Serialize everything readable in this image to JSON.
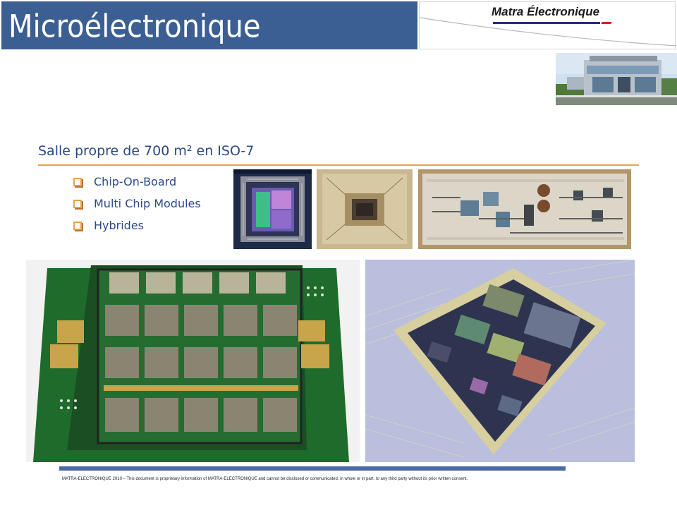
{
  "header": {
    "title": "Microélectronique",
    "logo_text": "Matra Électronique",
    "brand_blue": "#3b5f93",
    "accent_orange": "#e8a24a"
  },
  "section": {
    "title": "Salle propre de 700 m² en ISO-7",
    "bullets": [
      {
        "label": "Chip-On-Board"
      },
      {
        "label": "Multi Chip Modules"
      },
      {
        "label": "Hybrides"
      }
    ]
  },
  "images": {
    "building": "building-photo",
    "chip1": "chip-on-board-photo",
    "chip2": "multi-chip-module-photo",
    "chip3": "hybrid-circuit-photo",
    "board": "green-pcb-multichip-board-photo",
    "module": "ceramic-mcm-module-photo"
  },
  "footer": {
    "text": "MATRA-ELECTRONIQUE 2010 – This document is proprietary information of MATRA-ELECTRONIQUE and cannot be disclosed or communicated, in whole or in part, to any third party without its prior written consent."
  }
}
